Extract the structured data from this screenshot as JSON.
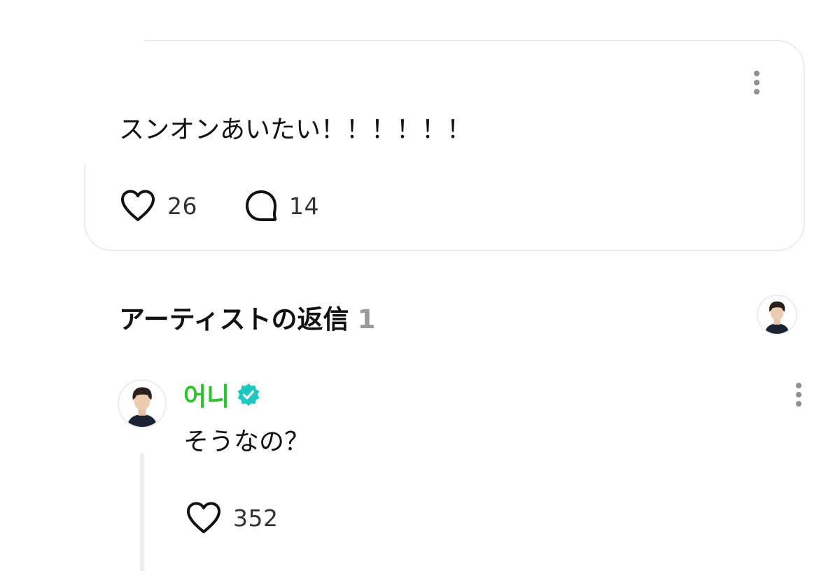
{
  "post": {
    "text": "スンオンあいたい！！！！！！",
    "likes": "26",
    "comments": "14"
  },
  "artist_replies": {
    "title": "アーティストの返信",
    "count": "1"
  },
  "reply": {
    "author": "어니",
    "text": "そうなの？",
    "likes": "352"
  },
  "colors": {
    "author_name": "#2fc22f",
    "verified_badge": "#1fc7c0",
    "card_border": "#ececf1",
    "count_gray": "#9a9a9e"
  },
  "icons": {
    "like": "heart-outline-icon",
    "comment": "speech-bubble-icon",
    "more": "vertical-ellipsis-icon",
    "verified": "verified-badge-icon"
  }
}
